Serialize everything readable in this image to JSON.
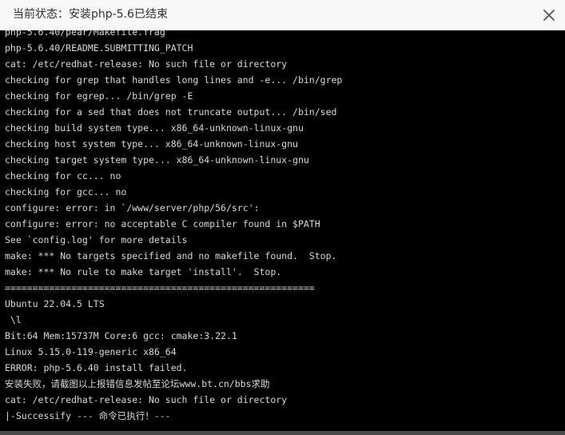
{
  "window": {
    "title": "当前状态：安装php-5.6已结束"
  },
  "terminal": {
    "lines": [
      "php-5.6.40/pear/Makefile.frag",
      "php-5.6.40/README.SUBMITTING_PATCH",
      "cat: /etc/redhat-release: No such file or directory",
      "checking for grep that handles long lines and -e... /bin/grep",
      "checking for egrep... /bin/grep -E",
      "checking for a sed that does not truncate output... /bin/sed",
      "checking build system type... x86_64-unknown-linux-gnu",
      "checking host system type... x86_64-unknown-linux-gnu",
      "checking target system type... x86_64-unknown-linux-gnu",
      "checking for cc... no",
      "checking for gcc... no",
      "configure: error: in `/www/server/php/56/src':",
      "configure: error: no acceptable C compiler found in $PATH",
      "See `config.log' for more details",
      "make: *** No targets specified and no makefile found.  Stop.",
      "make: *** No rule to make target 'install'.  Stop.",
      "========================================================",
      "Ubuntu 22.04.5 LTS",
      " \\l",
      "Bit:64 Mem:15737M Core:6 gcc: cmake:3.22.1",
      "Linux 5.15.0-119-generic x86_64",
      "ERROR: php-5.6.40 install failed.",
      "安装失败，请截图以上报错信息发帖至论坛www.bt.cn/bbs求助",
      "cat: /etc/redhat-release: No such file or directory",
      "|-Successify --- 命令已执行！---"
    ]
  },
  "icons": {
    "close": "close-icon"
  },
  "colors": {
    "titlebar_bg": "#f8f8f8",
    "terminal_bg": "#000000",
    "terminal_text": "#d8d8d8"
  }
}
